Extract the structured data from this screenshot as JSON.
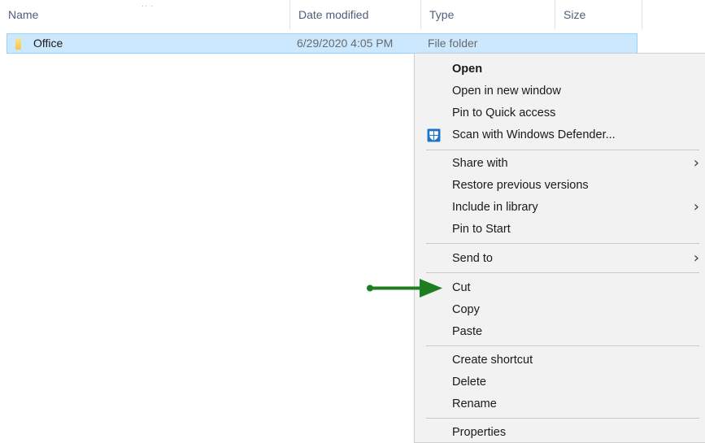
{
  "columns": {
    "name": "Name",
    "date_modified": "Date modified",
    "type": "Type",
    "size": "Size"
  },
  "file": {
    "name": "Office",
    "date_modified": "6/29/2020 4:05 PM",
    "type": "File folder",
    "icon": "folder-icon"
  },
  "context_menu": {
    "open": "Open",
    "open_new_window": "Open in new window",
    "pin_quick_access": "Pin to Quick access",
    "scan_defender": "Scan with Windows Defender...",
    "share_with": "Share with",
    "restore_previous": "Restore previous versions",
    "include_library": "Include in library",
    "pin_start": "Pin to Start",
    "send_to": "Send to",
    "cut": "Cut",
    "copy": "Copy",
    "paste": "Paste",
    "create_shortcut": "Create shortcut",
    "delete": "Delete",
    "rename": "Rename",
    "properties": "Properties",
    "submenu_icon": "chevron-right-icon"
  },
  "colors": {
    "selection_bg": "#cce8ff",
    "selection_border": "#99d1ff",
    "menu_bg": "#f2f2f2",
    "arrow": "#1e7d1e",
    "defender_blue": "#1a74c9"
  }
}
